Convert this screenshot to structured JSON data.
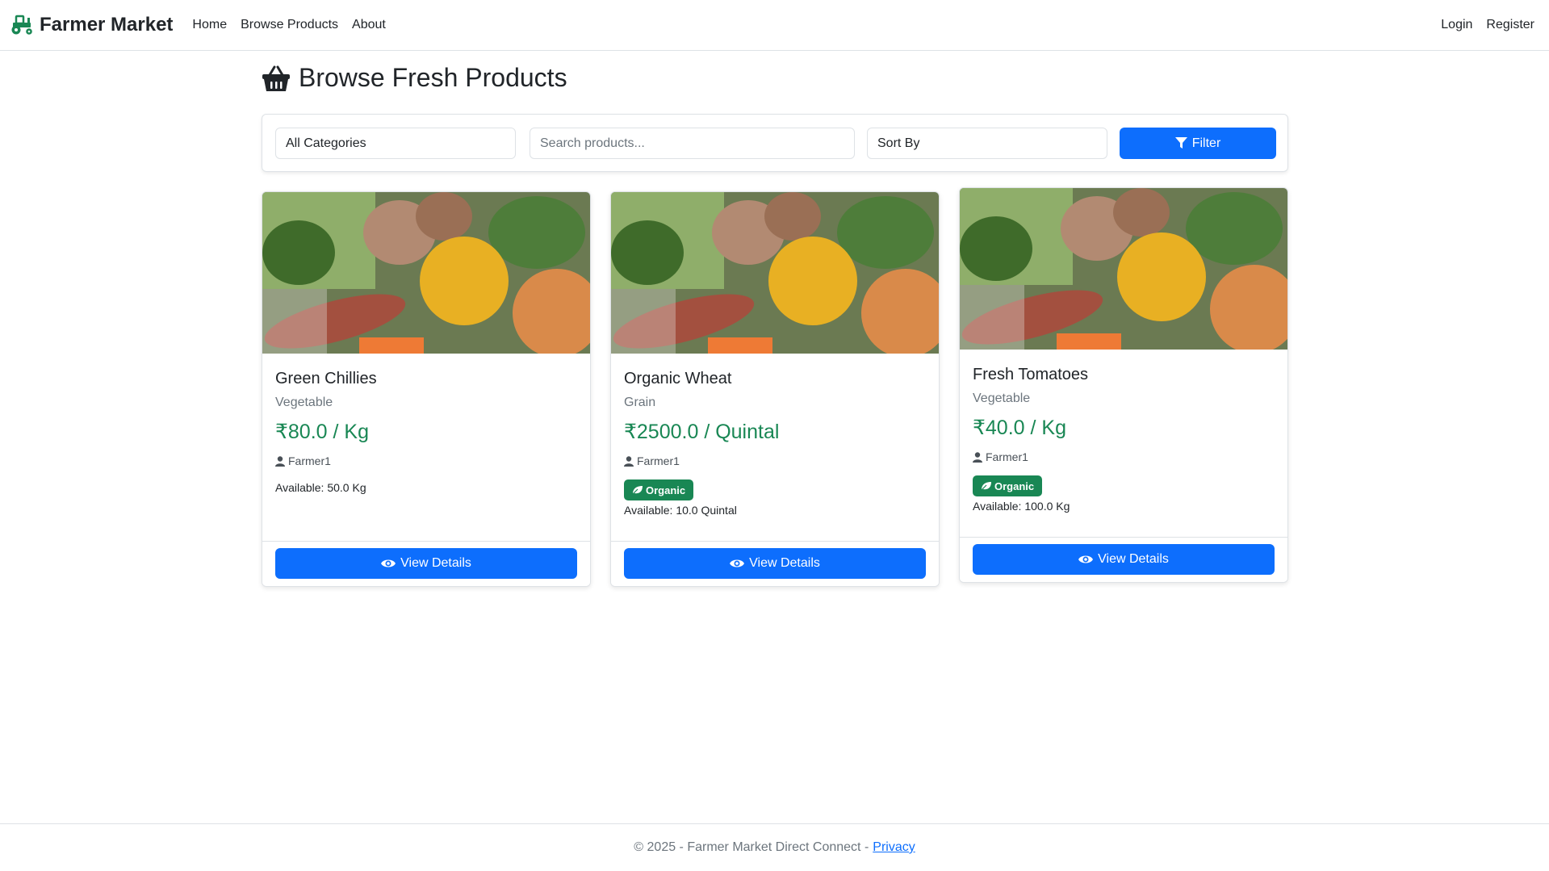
{
  "navbar": {
    "brand": "Farmer Market",
    "links": [
      "Home",
      "Browse Products",
      "About"
    ],
    "right_links": [
      "Login",
      "Register"
    ]
  },
  "page": {
    "title": "Browse Fresh Products"
  },
  "filters": {
    "category": "All Categories",
    "search_placeholder": "Search products...",
    "sort": "Sort By",
    "filter_button": "Filter"
  },
  "products": [
    {
      "name": "Green Chillies",
      "category": "Vegetable",
      "price": "₹80.0 / Kg",
      "farmer": "Farmer1",
      "organic": false,
      "available": "Available: 50.0 Kg",
      "button": "View Details"
    },
    {
      "name": "Organic Wheat",
      "category": "Grain",
      "price": "₹2500.0 / Quintal",
      "farmer": "Farmer1",
      "organic": true,
      "badge": "Organic",
      "available": "Available: 10.0 Quintal",
      "button": "View Details"
    },
    {
      "name": "Fresh Tomatoes",
      "category": "Vegetable",
      "price": "₹40.0 / Kg",
      "farmer": "Farmer1",
      "organic": true,
      "badge": "Organic",
      "available": "Available: 100.0 Kg",
      "button": "View Details"
    }
  ],
  "footer": {
    "text": "© 2025 - Farmer Market Direct Connect -",
    "privacy": "Privacy"
  },
  "colors": {
    "primary": "#0d6efd",
    "success": "#198754",
    "muted": "#6c757d",
    "border": "#dee2e6"
  },
  "icons": {
    "brand": "tractor-icon",
    "title": "basket-icon",
    "filter": "filter-icon",
    "farmer": "user-icon",
    "organic": "leaf-icon",
    "view": "eye-icon"
  }
}
